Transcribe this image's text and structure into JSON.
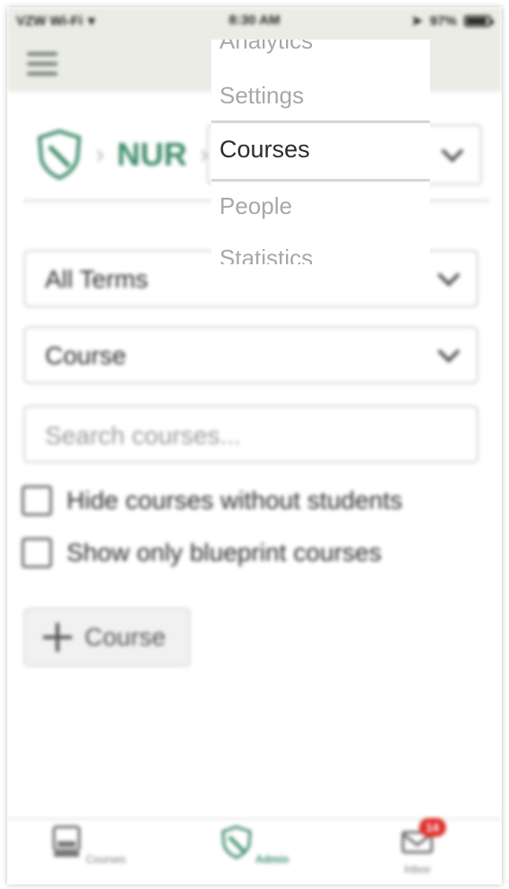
{
  "status_bar": {
    "carrier": "VZW Wi-Fi",
    "time": "8:30 AM",
    "battery": "97%"
  },
  "breadcrumb": {
    "account": "NUR",
    "separator": "›"
  },
  "filters": {
    "term_value": "All Terms",
    "type_value": "Course",
    "search_placeholder": "Search courses..."
  },
  "checkboxes": {
    "hide_without_students": "Hide courses without students",
    "show_blueprint_only": "Show only blueprint courses"
  },
  "add_course_label": "Course",
  "picker": {
    "options": [
      "Analytics",
      "Settings",
      "Courses",
      "People",
      "Statistics"
    ],
    "selected": "Courses"
  },
  "tab_bar": {
    "tabs": [
      {
        "label": "Courses",
        "icon": "courses-icon"
      },
      {
        "label": "Admin",
        "icon": "admin-shield-icon"
      },
      {
        "label": "Inbox",
        "icon": "inbox-icon"
      }
    ],
    "inbox_badge": "14"
  },
  "colors": {
    "brand_green": "#3e8c6a",
    "header_bg": "#ecece6",
    "badge_red": "#e0312d"
  }
}
